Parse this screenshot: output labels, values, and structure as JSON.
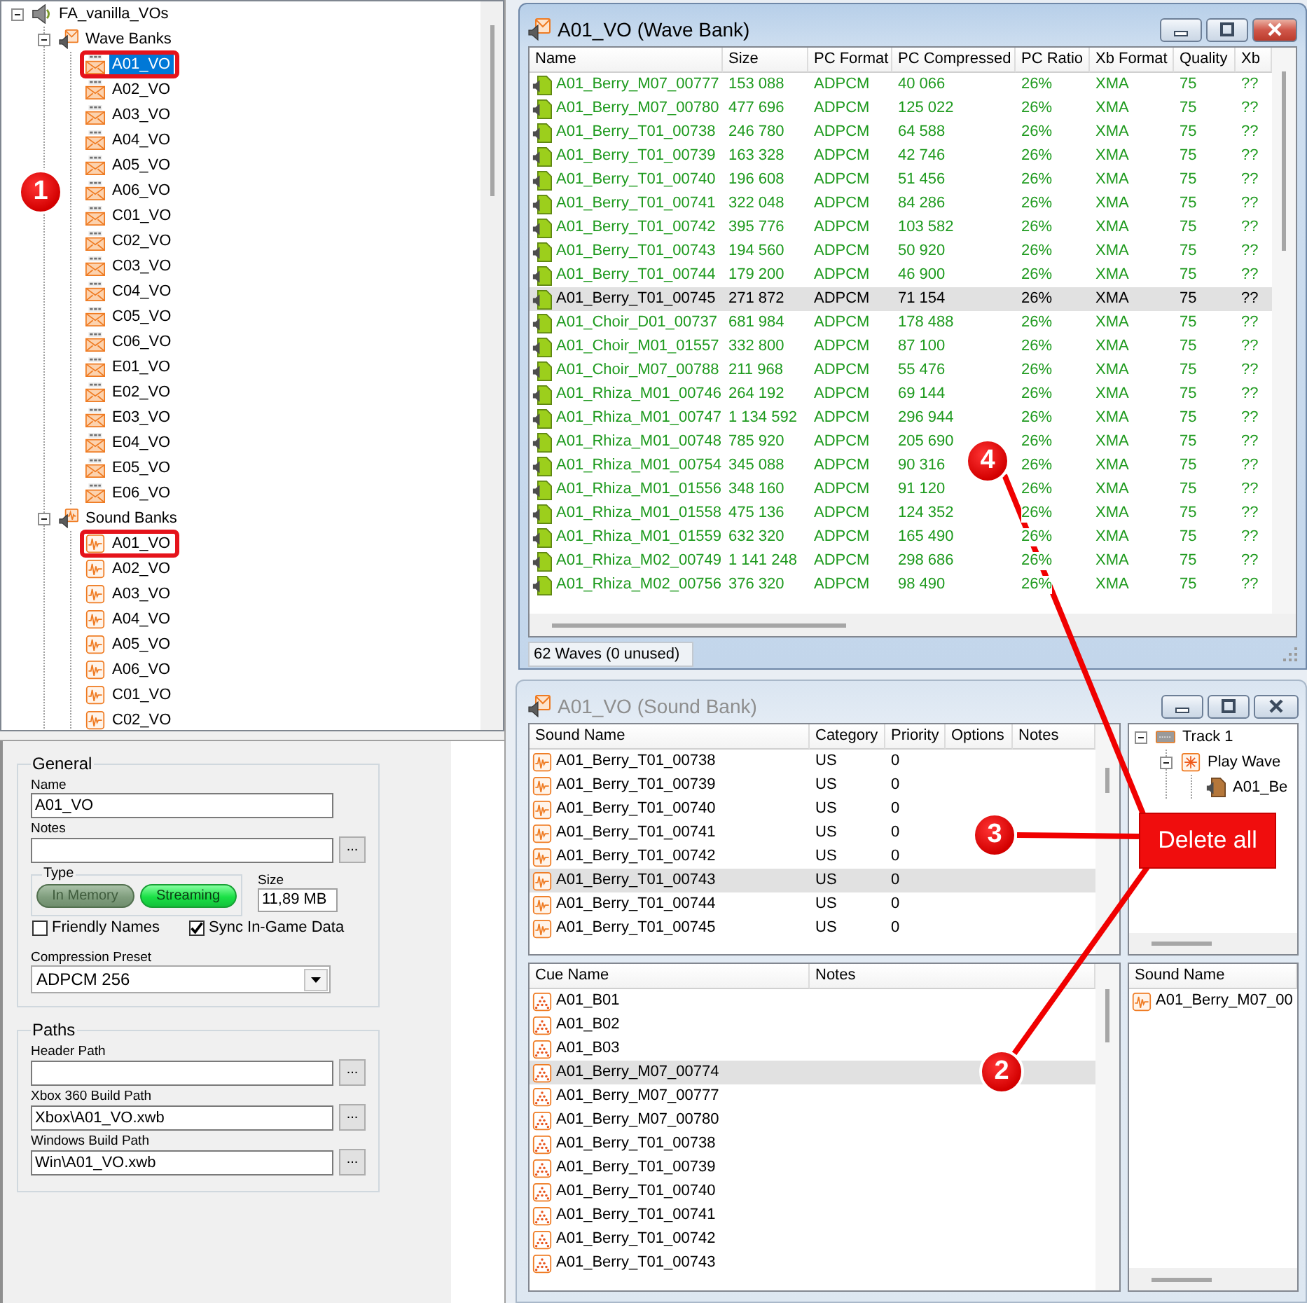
{
  "project_tree": [
    {
      "label": "FA_vanilla_VOs",
      "kind": "project",
      "expanded": true,
      "selected": false,
      "highlighted": false,
      "children": [
        {
          "label": "Wave Banks",
          "kind": "wavebanks",
          "expanded": true,
          "selected": false,
          "highlighted": false,
          "children": [
            {
              "label": "A01_VO",
              "kind": "wavebank",
              "selected": true,
              "highlighted": true
            },
            {
              "label": "A02_VO",
              "kind": "wavebank",
              "selected": false,
              "highlighted": false
            },
            {
              "label": "A03_VO",
              "kind": "wavebank",
              "selected": false,
              "highlighted": false
            },
            {
              "label": "A04_VO",
              "kind": "wavebank",
              "selected": false,
              "highlighted": false
            },
            {
              "label": "A05_VO",
              "kind": "wavebank",
              "selected": false,
              "highlighted": false
            },
            {
              "label": "A06_VO",
              "kind": "wavebank",
              "selected": false,
              "highlighted": false
            },
            {
              "label": "C01_VO",
              "kind": "wavebank",
              "selected": false,
              "highlighted": false
            },
            {
              "label": "C02_VO",
              "kind": "wavebank",
              "selected": false,
              "highlighted": false
            },
            {
              "label": "C03_VO",
              "kind": "wavebank",
              "selected": false,
              "highlighted": false
            },
            {
              "label": "C04_VO",
              "kind": "wavebank",
              "selected": false,
              "highlighted": false
            },
            {
              "label": "C05_VO",
              "kind": "wavebank",
              "selected": false,
              "highlighted": false
            },
            {
              "label": "C06_VO",
              "kind": "wavebank",
              "selected": false,
              "highlighted": false
            },
            {
              "label": "E01_VO",
              "kind": "wavebank",
              "selected": false,
              "highlighted": false
            },
            {
              "label": "E02_VO",
              "kind": "wavebank",
              "selected": false,
              "highlighted": false
            },
            {
              "label": "E03_VO",
              "kind": "wavebank",
              "selected": false,
              "highlighted": false
            },
            {
              "label": "E04_VO",
              "kind": "wavebank",
              "selected": false,
              "highlighted": false
            },
            {
              "label": "E05_VO",
              "kind": "wavebank",
              "selected": false,
              "highlighted": false
            },
            {
              "label": "E06_VO",
              "kind": "wavebank",
              "selected": false,
              "highlighted": false
            }
          ]
        },
        {
          "label": "Sound Banks",
          "kind": "soundbanks",
          "expanded": true,
          "selected": false,
          "highlighted": false,
          "children": [
            {
              "label": "A01_VO",
              "kind": "soundbank",
              "selected": false,
              "highlighted": true
            },
            {
              "label": "A02_VO",
              "kind": "soundbank",
              "selected": false,
              "highlighted": false
            },
            {
              "label": "A03_VO",
              "kind": "soundbank",
              "selected": false,
              "highlighted": false
            },
            {
              "label": "A04_VO",
              "kind": "soundbank",
              "selected": false,
              "highlighted": false
            },
            {
              "label": "A05_VO",
              "kind": "soundbank",
              "selected": false,
              "highlighted": false
            },
            {
              "label": "A06_VO",
              "kind": "soundbank",
              "selected": false,
              "highlighted": false
            },
            {
              "label": "C01_VO",
              "kind": "soundbank",
              "selected": false,
              "highlighted": false
            },
            {
              "label": "C02_VO",
              "kind": "soundbank",
              "selected": false,
              "highlighted": false
            }
          ]
        }
      ]
    }
  ],
  "properties": {
    "general": {
      "title": "General",
      "fields": [
        {
          "label": "Name",
          "value": "A01_VO"
        },
        {
          "label": "Notes",
          "button": "..."
        }
      ],
      "type": {
        "title": "Type",
        "options": [
          {
            "label": "In Memory",
            "selected": false
          },
          {
            "label": "Streaming",
            "selected": true
          }
        ]
      },
      "size": {
        "label": "Size",
        "value": "11,89 MB"
      },
      "checkboxes": [
        {
          "label": "Friendly Names",
          "checked": false
        },
        {
          "label": "Sync In-Game Data",
          "checked": true
        }
      ],
      "preset": {
        "label": "Compression Preset",
        "value": "ADPCM 256"
      }
    },
    "paths": {
      "title": "Paths",
      "fields": [
        {
          "label": "Header Path",
          "button": "..."
        },
        {
          "label": "Xbox 360 Build Path",
          "value": "Xbox\\A01_VO.xwb",
          "button": "..."
        },
        {
          "label": "Windows Build Path",
          "value": "Win\\A01_VO.xwb",
          "button": "..."
        }
      ]
    }
  },
  "wave_bank_window": {
    "title": "A01_VO (Wave Bank)",
    "active": true,
    "columns": [
      "Name",
      "Size",
      "PC Format",
      "PC Compressed",
      "PC Ratio",
      "Xb Format",
      "Quality",
      "Xb"
    ],
    "rows": [
      {
        "cells": [
          "A01_Berry_M07_00777",
          "153 088",
          "ADPCM",
          "40 066",
          "26%",
          "XMA",
          "75",
          "??"
        ],
        "selected": false
      },
      {
        "cells": [
          "A01_Berry_M07_00780",
          "477 696",
          "ADPCM",
          "125 022",
          "26%",
          "XMA",
          "75",
          "??"
        ],
        "selected": false
      },
      {
        "cells": [
          "A01_Berry_T01_00738",
          "246 780",
          "ADPCM",
          "64 588",
          "26%",
          "XMA",
          "75",
          "??"
        ],
        "selected": false
      },
      {
        "cells": [
          "A01_Berry_T01_00739",
          "163 328",
          "ADPCM",
          "42 746",
          "26%",
          "XMA",
          "75",
          "??"
        ],
        "selected": false
      },
      {
        "cells": [
          "A01_Berry_T01_00740",
          "196 608",
          "ADPCM",
          "51 456",
          "26%",
          "XMA",
          "75",
          "??"
        ],
        "selected": false
      },
      {
        "cells": [
          "A01_Berry_T01_00741",
          "322 048",
          "ADPCM",
          "84 286",
          "26%",
          "XMA",
          "75",
          "??"
        ],
        "selected": false
      },
      {
        "cells": [
          "A01_Berry_T01_00742",
          "395 776",
          "ADPCM",
          "103 582",
          "26%",
          "XMA",
          "75",
          "??"
        ],
        "selected": false
      },
      {
        "cells": [
          "A01_Berry_T01_00743",
          "194 560",
          "ADPCM",
          "50 920",
          "26%",
          "XMA",
          "75",
          "??"
        ],
        "selected": false
      },
      {
        "cells": [
          "A01_Berry_T01_00744",
          "179 200",
          "ADPCM",
          "46 900",
          "26%",
          "XMA",
          "75",
          "??"
        ],
        "selected": false
      },
      {
        "cells": [
          "A01_Berry_T01_00745",
          "271 872",
          "ADPCM",
          "71 154",
          "26%",
          "XMA",
          "75",
          "??"
        ],
        "selected": true
      },
      {
        "cells": [
          "A01_Choir_D01_00737",
          "681 984",
          "ADPCM",
          "178 488",
          "26%",
          "XMA",
          "75",
          "??"
        ],
        "selected": false
      },
      {
        "cells": [
          "A01_Choir_M01_01557",
          "332 800",
          "ADPCM",
          "87 100",
          "26%",
          "XMA",
          "75",
          "??"
        ],
        "selected": false
      },
      {
        "cells": [
          "A01_Choir_M07_00788",
          "211 968",
          "ADPCM",
          "55 476",
          "26%",
          "XMA",
          "75",
          "??"
        ],
        "selected": false
      },
      {
        "cells": [
          "A01_Rhiza_M01_00746",
          "264 192",
          "ADPCM",
          "69 144",
          "26%",
          "XMA",
          "75",
          "??"
        ],
        "selected": false
      },
      {
        "cells": [
          "A01_Rhiza_M01_00747",
          "1 134 592",
          "ADPCM",
          "296 944",
          "26%",
          "XMA",
          "75",
          "??"
        ],
        "selected": false
      },
      {
        "cells": [
          "A01_Rhiza_M01_00748",
          "785 920",
          "ADPCM",
          "205 690",
          "26%",
          "XMA",
          "75",
          "??"
        ],
        "selected": false
      },
      {
        "cells": [
          "A01_Rhiza_M01_00754",
          "345 088",
          "ADPCM",
          "90 316",
          "26%",
          "XMA",
          "75",
          "??"
        ],
        "selected": false
      },
      {
        "cells": [
          "A01_Rhiza_M01_01556",
          "348 160",
          "ADPCM",
          "91 120",
          "26%",
          "XMA",
          "75",
          "??"
        ],
        "selected": false
      },
      {
        "cells": [
          "A01_Rhiza_M01_01558",
          "475 136",
          "ADPCM",
          "124 352",
          "26%",
          "XMA",
          "75",
          "??"
        ],
        "selected": false
      },
      {
        "cells": [
          "A01_Rhiza_M01_01559",
          "632 320",
          "ADPCM",
          "165 490",
          "26%",
          "XMA",
          "75",
          "??"
        ],
        "selected": false
      },
      {
        "cells": [
          "A01_Rhiza_M02_00749",
          "1 141 248",
          "ADPCM",
          "298 686",
          "26%",
          "XMA",
          "75",
          "??"
        ],
        "selected": false
      },
      {
        "cells": [
          "A01_Rhiza_M02_00756",
          "376 320",
          "ADPCM",
          "98 490",
          "26%",
          "XMA",
          "75",
          "??"
        ],
        "selected": false
      }
    ],
    "status": "62 Waves (0 unused)"
  },
  "sound_bank_window": {
    "title": "A01_VO (Sound Bank)",
    "active": false,
    "sounds": {
      "columns": [
        "Sound Name",
        "Category",
        "Priority",
        "Options",
        "Notes"
      ],
      "rows": [
        {
          "cells": [
            "A01_Berry_T01_00738",
            "US",
            "0"
          ],
          "selected": false
        },
        {
          "cells": [
            "A01_Berry_T01_00739",
            "US",
            "0"
          ],
          "selected": false
        },
        {
          "cells": [
            "A01_Berry_T01_00740",
            "US",
            "0"
          ],
          "selected": false
        },
        {
          "cells": [
            "A01_Berry_T01_00741",
            "US",
            "0"
          ],
          "selected": false
        },
        {
          "cells": [
            "A01_Berry_T01_00742",
            "US",
            "0"
          ],
          "selected": false
        },
        {
          "cells": [
            "A01_Berry_T01_00743",
            "US",
            "0"
          ],
          "selected": true
        },
        {
          "cells": [
            "A01_Berry_T01_00744",
            "US",
            "0"
          ],
          "selected": false
        },
        {
          "cells": [
            "A01_Berry_T01_00745",
            "US",
            "0"
          ],
          "selected": false
        }
      ]
    },
    "track_tree": [
      {
        "label": "Track 1",
        "kind": "track",
        "expanded": true,
        "children": [
          {
            "label": "Play Wave",
            "kind": "event",
            "expanded": true,
            "children": [
              {
                "label": "A01_Be",
                "kind": "wave"
              }
            ]
          }
        ]
      }
    ],
    "cues": {
      "columns": [
        "Cue Name",
        "Notes"
      ],
      "rows": [
        {
          "cells": [
            "A01_B01"
          ],
          "selected": false
        },
        {
          "cells": [
            "A01_B02"
          ],
          "selected": false
        },
        {
          "cells": [
            "A01_B03"
          ],
          "selected": false
        },
        {
          "cells": [
            "A01_Berry_M07_00774"
          ],
          "selected": true
        },
        {
          "cells": [
            "A01_Berry_M07_00777"
          ],
          "selected": false
        },
        {
          "cells": [
            "A01_Berry_M07_00780"
          ],
          "selected": false
        },
        {
          "cells": [
            "A01_Berry_T01_00738"
          ],
          "selected": false
        },
        {
          "cells": [
            "A01_Berry_T01_00739"
          ],
          "selected": false
        },
        {
          "cells": [
            "A01_Berry_T01_00740"
          ],
          "selected": false
        },
        {
          "cells": [
            "A01_Berry_T01_00741"
          ],
          "selected": false
        },
        {
          "cells": [
            "A01_Berry_T01_00742"
          ],
          "selected": false
        },
        {
          "cells": [
            "A01_Berry_T01_00743"
          ],
          "selected": false
        }
      ]
    },
    "sound_refs": {
      "columns": [
        "Sound Name"
      ],
      "rows": [
        {
          "cells": [
            "A01_Berry_M07_00"
          ]
        }
      ]
    }
  },
  "annotations": {
    "markers": [
      {
        "label": "1"
      },
      {
        "label": "4"
      },
      {
        "label": "3"
      },
      {
        "label": "2"
      }
    ],
    "callout": "Delete all"
  }
}
